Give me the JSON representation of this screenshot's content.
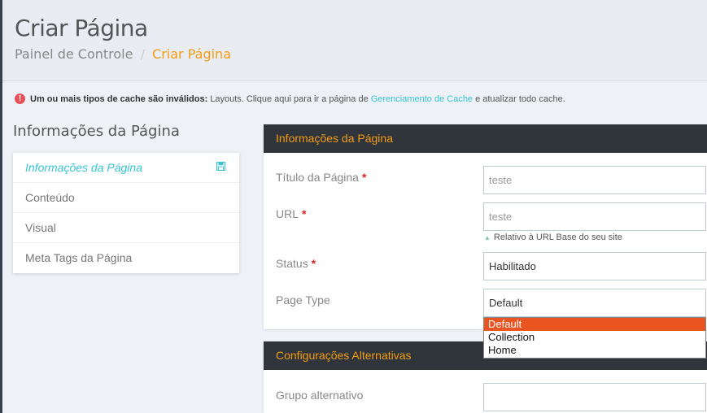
{
  "header": {
    "title": "Criar Página",
    "breadcrumb": {
      "home": "Painel de Controle",
      "separator": "/",
      "current": "Criar Página"
    }
  },
  "alert": {
    "icon": "exclamation-icon",
    "bold": "Um ou mais tipos de cache são inválidos:",
    "text_before": "Layouts. Clique aqui para ir a página de",
    "link": "Gerenciamento de Cache",
    "text_after": "e atualizar todo cache."
  },
  "sidebar": {
    "title": "Informações da Página",
    "items": [
      {
        "label": "Informações da Página"
      },
      {
        "label": "Conteúdo"
      },
      {
        "label": "Visual"
      },
      {
        "label": "Meta Tags da Página"
      }
    ]
  },
  "panel_info": {
    "title": "Informações da Página",
    "fields": {
      "title_label": "Título da Página",
      "title_value": "teste",
      "url_label": "URL",
      "url_value": "teste",
      "url_hint": "Relativo à URL Base do seu site",
      "status_label": "Status",
      "status_value": "Habilitado",
      "page_type_label": "Page Type",
      "page_type_value": "Default"
    },
    "required_mark": "*"
  },
  "dropdown": {
    "options": [
      "Default",
      "Collection",
      "Home"
    ],
    "selected": "Default"
  },
  "panel_alt": {
    "title": "Configurações Alternativas",
    "group_label": "Grupo alternativo",
    "group_value": ""
  },
  "colors": {
    "accent": "#f39c12",
    "link": "#36c6d3",
    "panel_header": "#2f353b",
    "dropdown_highlight": "#e95420",
    "required": "#e02222"
  }
}
